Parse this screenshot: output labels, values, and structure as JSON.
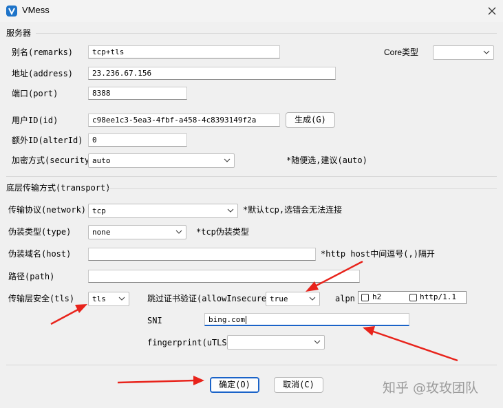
{
  "window": {
    "title": "VMess",
    "icon": "v-logo-icon"
  },
  "server": {
    "section_title": "服务器",
    "remarks": {
      "label": "别名(remarks)",
      "value": "tcp+tls"
    },
    "core_type": {
      "label": "Core类型",
      "value": ""
    },
    "address": {
      "label": "地址(address)",
      "value": "23.236.67.156"
    },
    "port": {
      "label": "端口(port)",
      "value": "8388"
    },
    "user_id": {
      "label": "用户ID(id)",
      "value": "c98ee1c3-5ea3-4fbf-a458-4c8393149f2a"
    },
    "generate_button": "生成(G)",
    "alter_id": {
      "label": "额外ID(alterId)",
      "value": "0"
    },
    "security": {
      "label": "加密方式(security)",
      "value": "auto",
      "hint": "*随便选,建议(auto)"
    }
  },
  "transport": {
    "section_title": "底层传输方式(transport)",
    "network": {
      "label": "传输协议(network)",
      "value": "tcp",
      "hint": "*默认tcp,选错会无法连接"
    },
    "type": {
      "label": "伪装类型(type)",
      "value": "none",
      "hint": "*tcp伪装类型"
    },
    "host": {
      "label": "伪装域名(host)",
      "value": "",
      "hint": "*http host中间逗号(,)隔开"
    },
    "path": {
      "label": "路径(path)",
      "value": ""
    },
    "tls": {
      "label": "传输层安全(tls)",
      "value": "tls"
    },
    "allow_insecure": {
      "label": "跳过证书验证(allowInsecure)",
      "value": "true"
    },
    "alpn": {
      "label": "alpn",
      "options": [
        "h2",
        "http/1.1"
      ]
    },
    "sni": {
      "label": "SNI",
      "value": "bing.com"
    },
    "fingerprint": {
      "label": "fingerprint(uTLS)",
      "value": ""
    }
  },
  "footer": {
    "ok_button": "确定(O)",
    "cancel_button": "取消(C)"
  },
  "watermark": "知乎 @玫玫团队",
  "colors": {
    "annotation_arrow": "#e8231b",
    "focus_accent": "#1a63c8",
    "app_icon": "#1f74c9"
  }
}
